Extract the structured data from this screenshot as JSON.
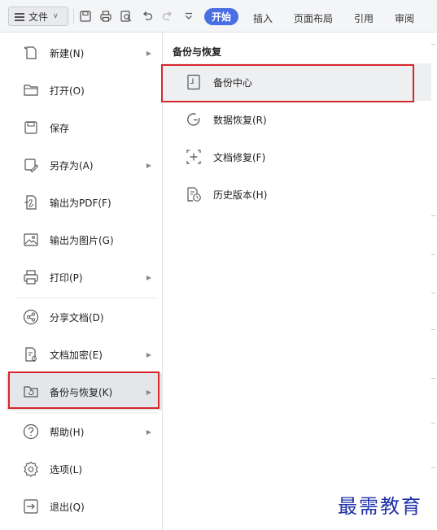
{
  "toolbar": {
    "file_label": "文件",
    "tabs": [
      "开始",
      "插入",
      "页面布局",
      "引用",
      "审阅"
    ],
    "icons": [
      "save-icon",
      "print-icon",
      "print-preview-icon",
      "undo-icon",
      "redo-icon",
      "more-icon"
    ]
  },
  "menu": {
    "items": [
      {
        "label": "新建(N)",
        "icon": "new-document-icon",
        "submenu": true
      },
      {
        "label": "打开(O)",
        "icon": "folder-open-icon",
        "submenu": false
      },
      {
        "label": "保存",
        "icon": "save-icon",
        "submenu": false
      },
      {
        "label": "另存为(A)",
        "icon": "save-as-icon",
        "submenu": true
      },
      {
        "label": "输出为PDF(F)",
        "icon": "export-pdf-icon",
        "submenu": false
      },
      {
        "label": "输出为图片(G)",
        "icon": "export-image-icon",
        "submenu": false
      },
      {
        "label": "打印(P)",
        "icon": "print-icon",
        "submenu": true
      },
      {
        "label": "分享文档(D)",
        "icon": "share-icon",
        "submenu": false
      },
      {
        "label": "文档加密(E)",
        "icon": "encrypt-icon",
        "submenu": true
      },
      {
        "label": "备份与恢复(K)",
        "icon": "backup-restore-icon",
        "submenu": true,
        "active": true
      },
      {
        "label": "帮助(H)",
        "icon": "help-icon",
        "submenu": true
      },
      {
        "label": "选项(L)",
        "icon": "settings-icon",
        "submenu": false
      },
      {
        "label": "退出(Q)",
        "icon": "exit-icon",
        "submenu": false
      }
    ]
  },
  "submenu": {
    "title": "备份与恢复",
    "items": [
      {
        "label": "备份中心",
        "icon": "backup-center-icon",
        "active": true
      },
      {
        "label": "数据恢复(R)",
        "icon": "data-recovery-icon"
      },
      {
        "label": "文档修复(F)",
        "icon": "document-repair-icon"
      },
      {
        "label": "历史版本(H)",
        "icon": "history-version-icon"
      }
    ]
  },
  "watermark": "最需教育",
  "colors": {
    "accent": "#4a6fe3",
    "highlight_border": "#d7262e",
    "watermark": "#2030a8"
  }
}
